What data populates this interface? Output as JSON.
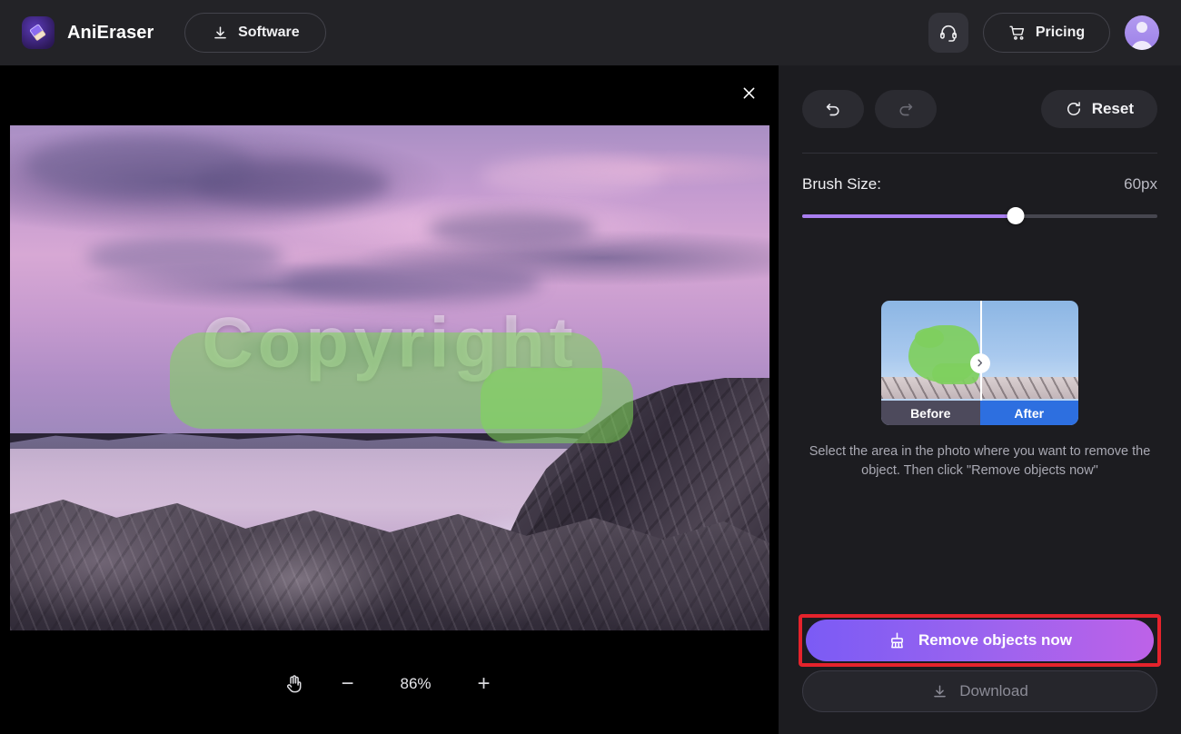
{
  "topbar": {
    "brand_name": "AniEraser",
    "logo_icon": "eraser-logo-icon",
    "software_label": "Software",
    "software_icon": "download-icon",
    "support_icon": "headset-icon",
    "pricing_label": "Pricing",
    "pricing_icon": "shopping-cart-icon",
    "avatar_icon": "user-avatar-icon"
  },
  "canvas": {
    "close_icon": "close-icon",
    "watermark_text": "Copyright",
    "mask_color": "#7ed957",
    "zoom": {
      "pan_icon": "hand-pan-icon",
      "zoom_out_label": "−",
      "zoom_level": "86%",
      "zoom_in_label": "+"
    }
  },
  "panel": {
    "undo_icon": "undo-arrow-icon",
    "redo_icon": "redo-arrow-icon",
    "reset_label": "Reset",
    "reset_icon": "reset-circular-arrow-icon",
    "brush": {
      "label": "Brush Size:",
      "value": "60px",
      "percent": 60,
      "fill_color": "#a97ef0"
    },
    "preview": {
      "before_label": "Before",
      "after_label": "After",
      "handle_icon": "chevron-right-icon"
    },
    "hint_text": "Select the area in the photo where you want to remove the object. Then click \"Remove objects now\"",
    "remove_button": {
      "label": "Remove objects now",
      "icon": "brush-broom-icon",
      "gradient_start": "#7b5bf5",
      "gradient_end": "#bd62e8",
      "highlight_color": "#e5232c"
    },
    "download_button": {
      "label": "Download",
      "icon": "download-icon"
    }
  }
}
